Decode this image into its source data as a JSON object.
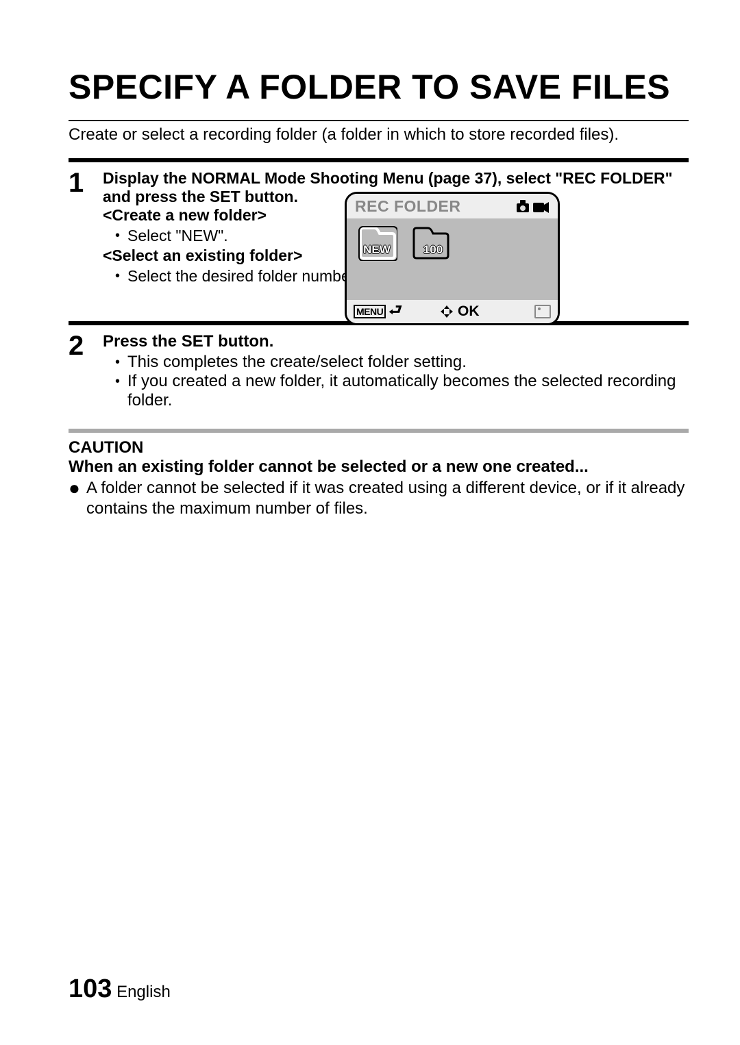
{
  "title": "SPECIFY A FOLDER TO SAVE FILES",
  "intro": "Create or select a recording folder (a folder in which to store recorded files).",
  "step1": {
    "num": "1",
    "head": "Display the NORMAL Mode Shooting Menu (page 37), select \"REC FOLDER\" and press the SET button.",
    "create_head": "<Create a new folder>",
    "create_bullet": "Select \"NEW\".",
    "select_head": "<Select an existing folder>",
    "select_bullet": "Select the desired folder number."
  },
  "lcd": {
    "title": "REC FOLDER",
    "folder_new": "NEW",
    "folder_100": "100",
    "menu_label": "MENU",
    "ok_label": "OK"
  },
  "step2": {
    "num": "2",
    "head": "Press the SET button.",
    "b1": "This completes the create/select folder setting.",
    "b2": "If you created a new folder, it automatically becomes the selected recording folder."
  },
  "caution": {
    "title": "CAUTION",
    "sub": "When an existing folder cannot be selected or a new one created...",
    "bullet": "A folder cannot be selected if it was created using a different device, or if it already contains the maximum number of files."
  },
  "footer": {
    "page": "103",
    "lang": "English"
  }
}
